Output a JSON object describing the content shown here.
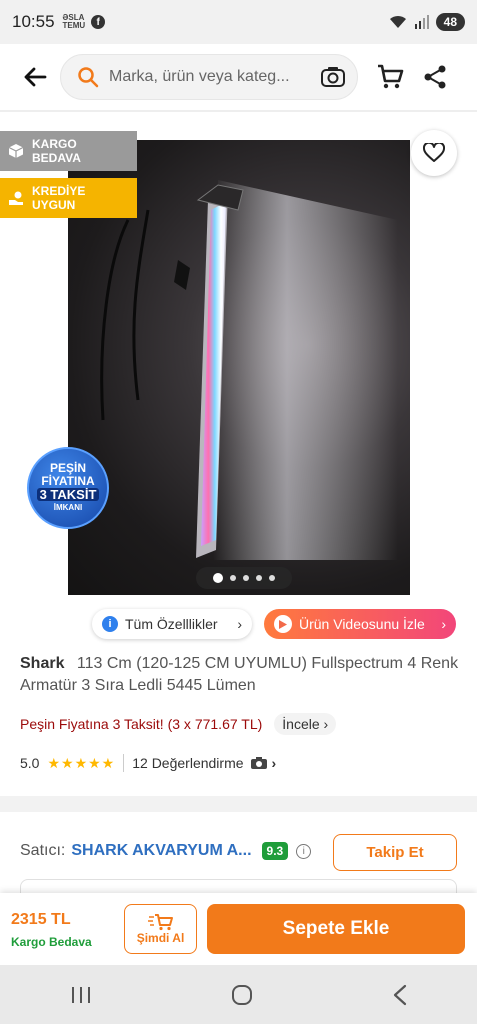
{
  "status_bar": {
    "time": "10:55",
    "mini_app_top": "ƏSLA",
    "mini_app_bottom": "TEMU",
    "facebook_glyph": "f",
    "battery": "48"
  },
  "header": {
    "search_placeholder": "Marka, ürün veya kateg..."
  },
  "badges": {
    "kargo_line1": "KARGO",
    "kargo_line2": "BEDAVA",
    "kredi_line1": "KREDİYE",
    "kredi_line2": "UYGUN"
  },
  "promo": {
    "line1": "PEŞİN",
    "line2": "FİYATINA",
    "line3": "3 TAKSİT",
    "line4": "İMKANI"
  },
  "gallery": {
    "total_images": 5,
    "active_index": 0
  },
  "actions": {
    "all_features": "Tüm Özelllikler",
    "watch_video": "Ürün Videosunu İzle"
  },
  "product": {
    "brand": "Shark",
    "title": "113 Cm (120-125 CM UYUMLU) Fullspectrum 4 Renk Armatür 3 Sıra Ledli 5445 Lümen",
    "installment_text": "Peşin Fiyatına 3 Taksit! (3 x 771.67 TL)",
    "installment_link": "İncele",
    "rating_value": "5.0",
    "stars": "★★★★★",
    "reviews": "12 Değerlendirme"
  },
  "seller": {
    "label": "Satıcı:",
    "name": "SHARK AKVARYUM A...",
    "score": "9.3",
    "follow": "Takip Et"
  },
  "bottom": {
    "price": "2315 TL",
    "shipping": "Kargo Bedava",
    "buy_now": "Şimdi Al",
    "add_to_cart": "Sepete Ekle"
  },
  "colors": {
    "accent": "#f27a1a",
    "installment_red": "#9b0a0a",
    "score_green": "#1f9d3a",
    "seller_blue": "#2f6fc0"
  }
}
